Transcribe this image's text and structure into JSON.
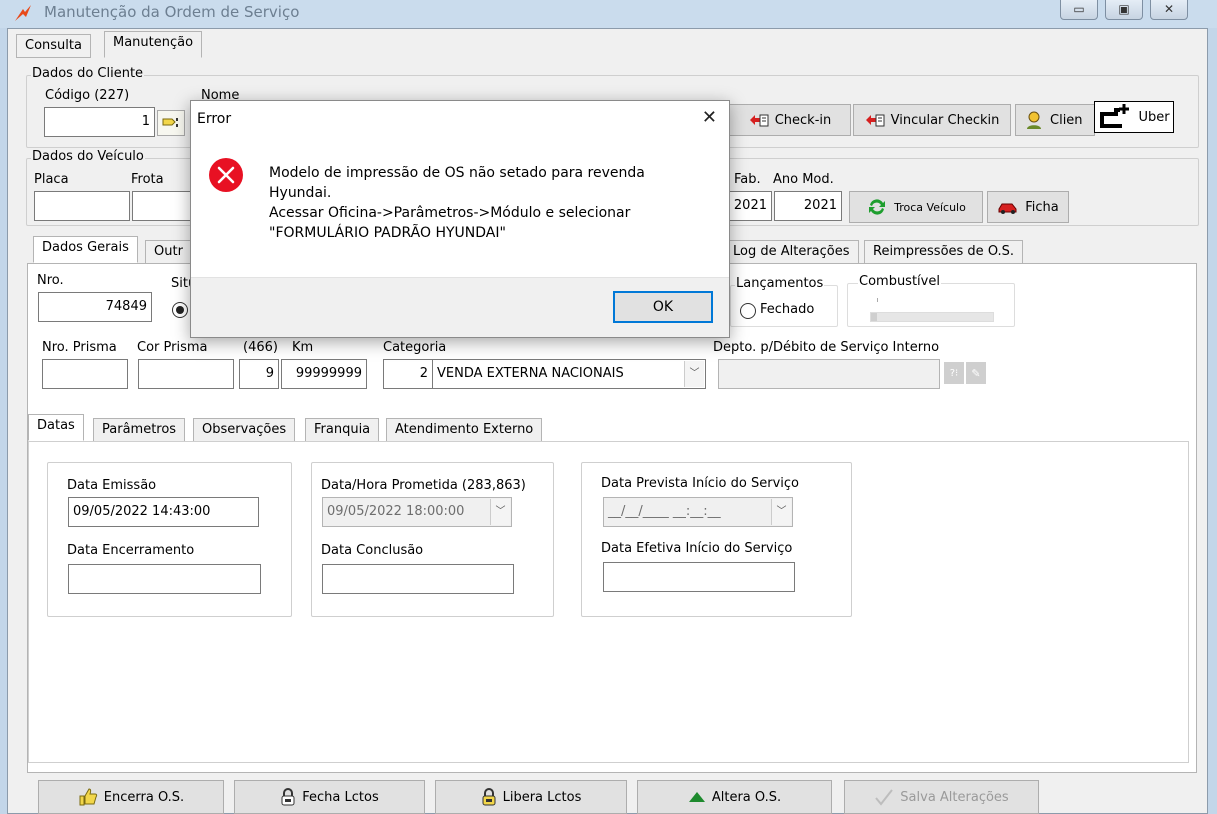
{
  "window": {
    "title": "Manutenção da Ordem de Serviço",
    "accent": "#cadced"
  },
  "top_tabs": [
    "Consulta",
    "Manutenção"
  ],
  "cliente": {
    "group_title": "Dados do Cliente",
    "codigo_label": "Código (227)",
    "codigo_value": "1",
    "nome_label": "Nome",
    "buttons": {
      "checkin": "Check-in",
      "vincular": "Vincular Checkin",
      "cliente": "Clien",
      "uber": "Uber"
    }
  },
  "veiculo": {
    "group_title": "Dados do Veículo",
    "placa_label": "Placa",
    "frota_label": "Frota",
    "anofab_label": "Fab.",
    "anomod_label": "Ano Mod.",
    "anofab_value": "2021",
    "anomod_value": "2021",
    "troca_button": "Troca Veículo",
    "ficha_button": "Ficha"
  },
  "mid_tabs": {
    "dados_gerais": "Dados Gerais",
    "outros": "Outr",
    "log": "Log de Alterações",
    "reimpressoes": "Reimpressões de O.S."
  },
  "dados_gerais": {
    "nro_label": "Nro.",
    "nro_value": "74849",
    "situacao_label": "Situ",
    "lancamentos_label": "Lançamentos",
    "fechado_label": "Fechado",
    "combustivel_label": "Combustível",
    "combustivel_level": 0.05,
    "prisma_label": "Nro. Prisma",
    "cor_prisma_label": "Cor Prisma",
    "c466_label": "(466)",
    "c466_value": "9",
    "km_label": "Km",
    "km_value": "99999999",
    "categoria_label": "Categoria",
    "categoria_code": "2",
    "categoria_value": "VENDA EXTERNA NACIONAIS",
    "depto_label": "Depto. p/Débito de Serviço Interno"
  },
  "sub_tabs": [
    "Datas",
    "Parâmetros",
    "Observações",
    "Franquia",
    "Atendimento Externo"
  ],
  "datas": {
    "emissao_label": "Data Emissão",
    "emissao_value": "09/05/2022 14:43:00",
    "encerramento_label": "Data Encerramento",
    "prometida_label": "Data/Hora Prometida (283,863)",
    "prometida_value": "09/05/2022 18:00:00",
    "conclusao_label": "Data Conclusão",
    "prevista_label": "Data Prevista Início do Serviço",
    "prevista_mask": "__/__/____ __:__:__",
    "efetiva_label": "Data Efetiva Início do Serviço"
  },
  "bottom_buttons": {
    "encerra": "Encerra O.S.",
    "fecha": "Fecha Lctos",
    "libera": "Libera Lctos",
    "altera": "Altera O.S.",
    "salva": "Salva Alterações"
  },
  "dialog": {
    "title": "Error",
    "message_lines": [
      "Modelo de impressão de OS não setado para revenda",
      "Hyundai.",
      "Acessar Oficina->Parâmetros->Módulo e selecionar",
      "\"FORMULÁRIO PADRÃO HYUNDAI\""
    ],
    "ok_label": "OK",
    "error_color": "#e81123"
  }
}
